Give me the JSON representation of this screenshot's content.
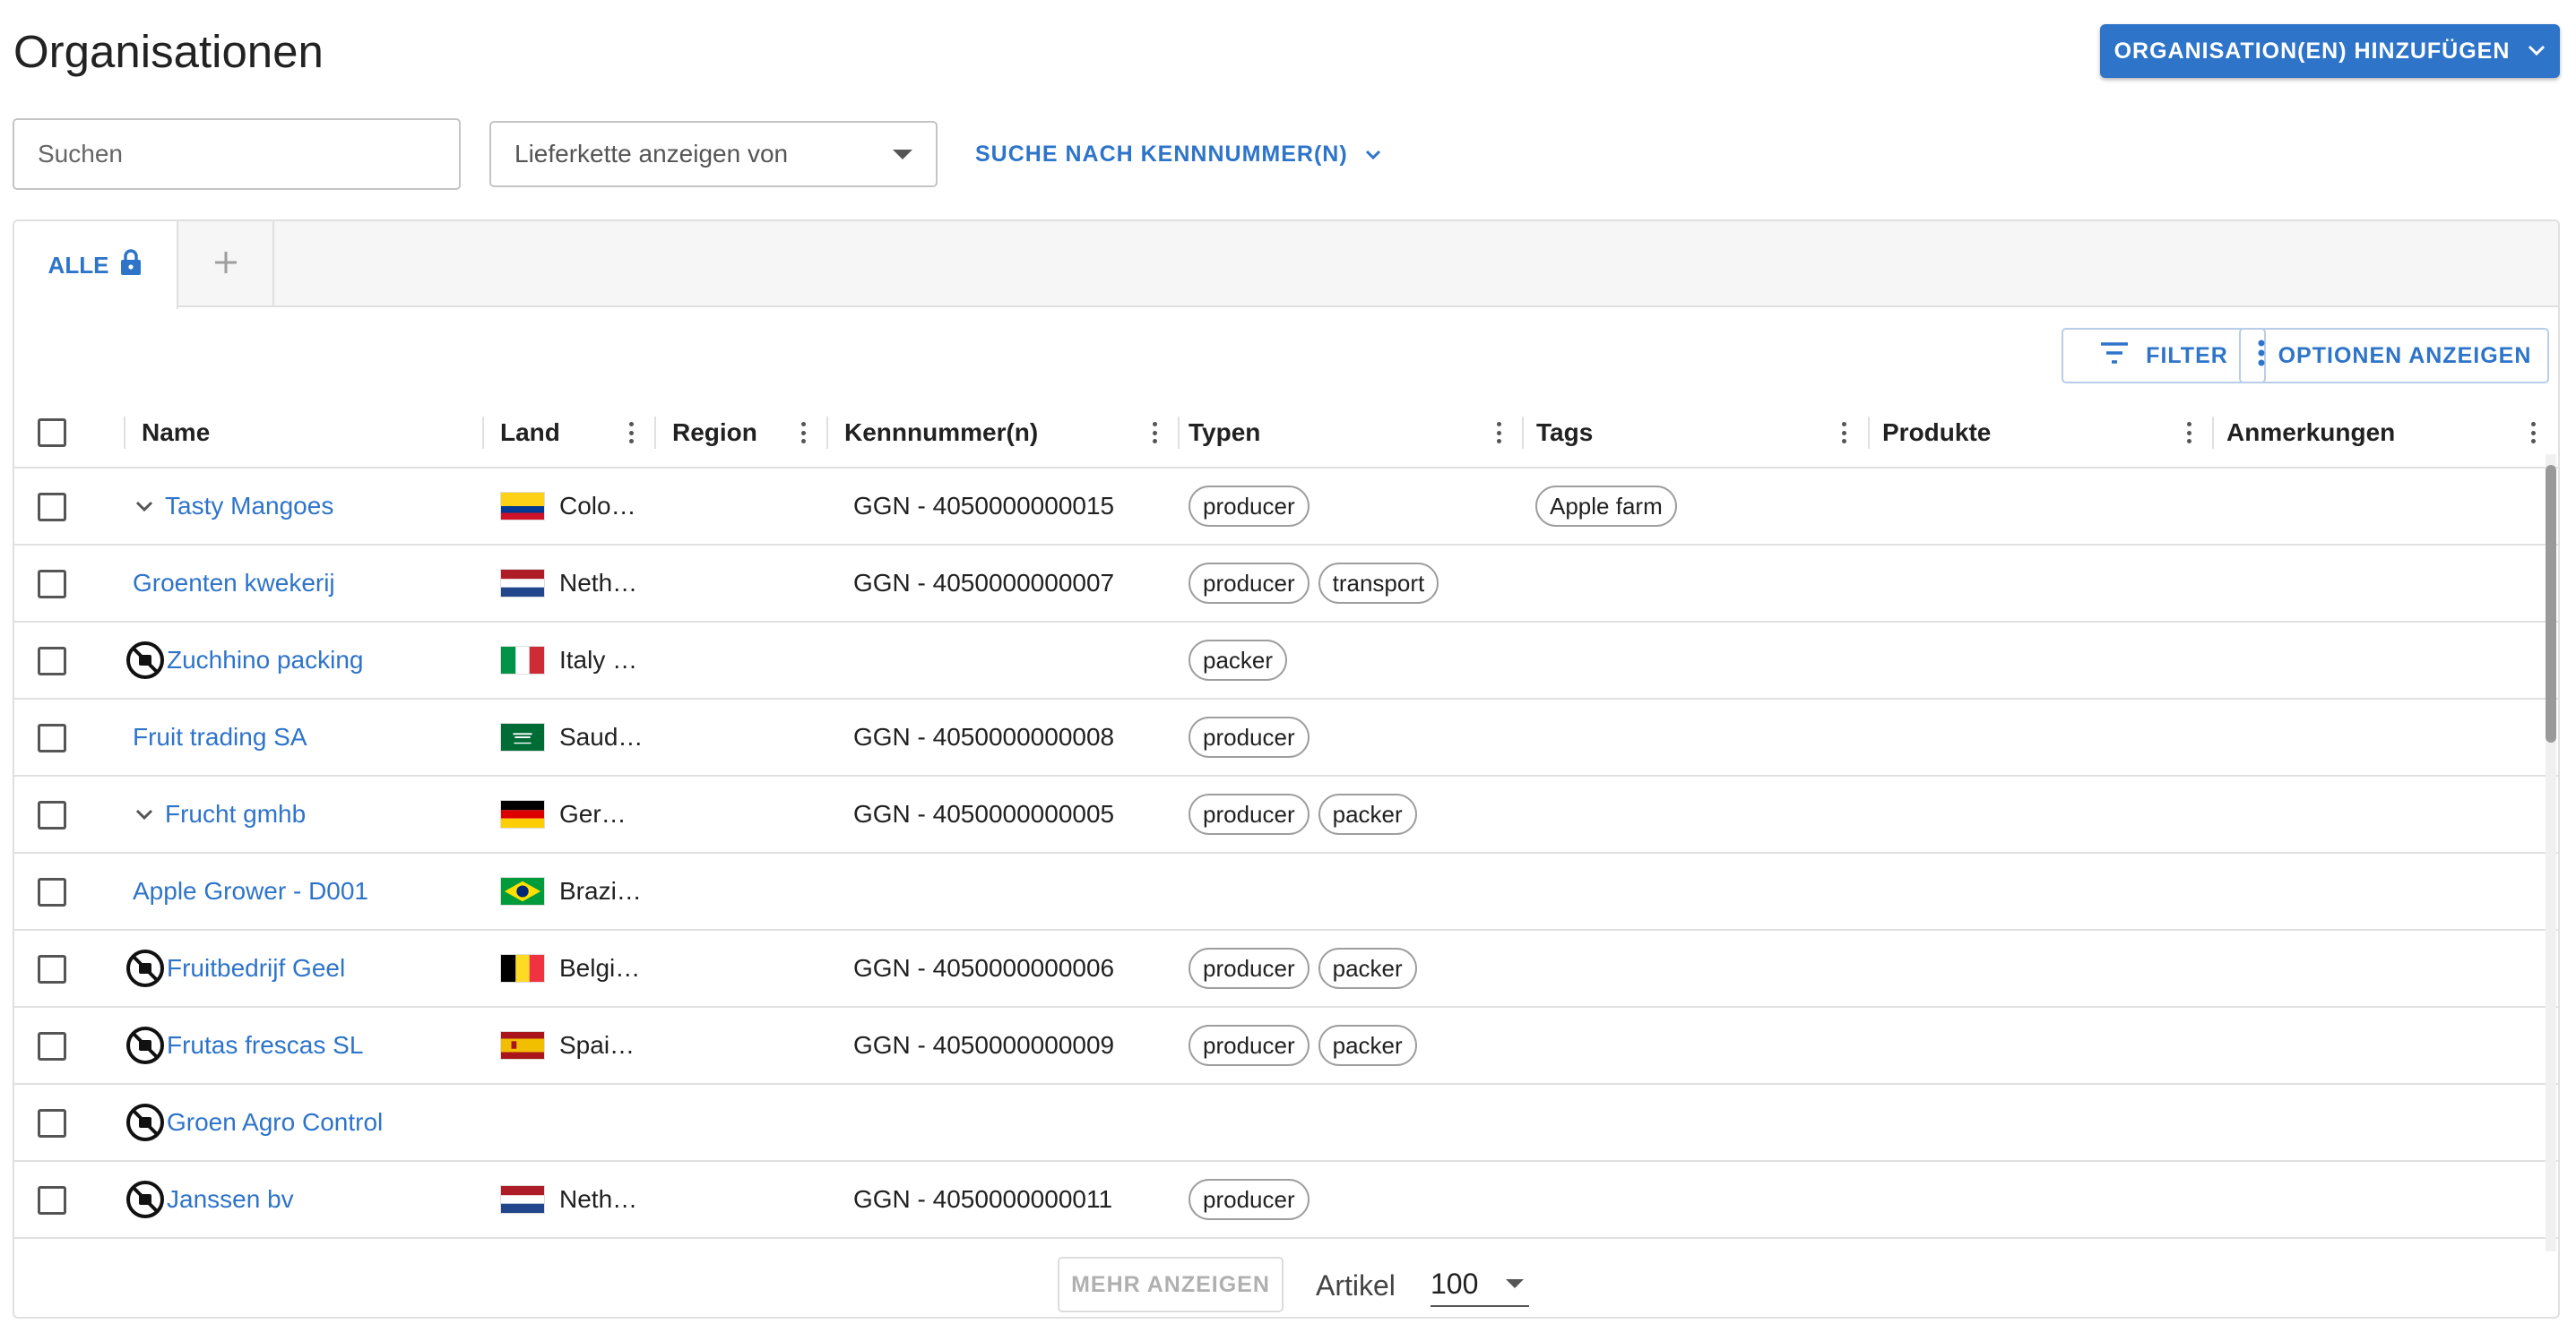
{
  "header": {
    "title": "Organisationen",
    "add_button_label": "ORGANISATION(EN) HINZUFÜGEN"
  },
  "toolbar": {
    "search_placeholder": "Suchen",
    "supply_chain_placeholder": "Lieferkette anzeigen von",
    "id_search_label": "SUCHE NACH KENNNUMMER(N)"
  },
  "tabs": {
    "all_label": "ALLE"
  },
  "actions": {
    "filter_label": "FILTER",
    "options_label": "OPTIONEN ANZEIGEN"
  },
  "columns": [
    "Name",
    "Land",
    "Region",
    "Kennnummer(n)",
    "Typen",
    "Tags",
    "Produkte",
    "Anmerkungen"
  ],
  "rows": [
    {
      "name": "Tasty Mangoes",
      "icon": "expand",
      "country": "Colo…",
      "flag": "colombia",
      "id": "GGN - 4050000000015",
      "types": [
        "producer"
      ],
      "tags": [
        "Apple farm"
      ]
    },
    {
      "name": "Groenten kwekerij",
      "icon": "none",
      "country": "Neth…",
      "flag": "netherlands",
      "id": "GGN - 4050000000007",
      "types": [
        "producer",
        "transport"
      ],
      "tags": []
    },
    {
      "name": "Zuchhino packing",
      "icon": "blocked",
      "country": "Italy …",
      "flag": "italy",
      "id": "",
      "types": [
        "packer"
      ],
      "tags": []
    },
    {
      "name": "Fruit trading SA",
      "icon": "none",
      "country": "Saud…",
      "flag": "saudi-arabia",
      "id": "GGN - 4050000000008",
      "types": [
        "producer"
      ],
      "tags": []
    },
    {
      "name": "Frucht gmhb",
      "icon": "expand",
      "country": "Ger…",
      "flag": "germany",
      "id": "GGN - 4050000000005",
      "types": [
        "producer",
        "packer"
      ],
      "tags": []
    },
    {
      "name": "Apple Grower - D001",
      "icon": "none",
      "country": "Brazi…",
      "flag": "brazil",
      "id": "",
      "types": [],
      "tags": []
    },
    {
      "name": "Fruitbedrijf Geel",
      "icon": "blocked",
      "country": "Belgi…",
      "flag": "belgium",
      "id": "GGN - 4050000000006",
      "types": [
        "producer",
        "packer"
      ],
      "tags": []
    },
    {
      "name": "Frutas frescas SL",
      "icon": "blocked",
      "country": "Spai…",
      "flag": "spain",
      "id": "GGN - 4050000000009",
      "types": [
        "producer",
        "packer"
      ],
      "tags": []
    },
    {
      "name": "Groen Agro Control",
      "icon": "blocked",
      "country": "",
      "flag": "",
      "id": "",
      "types": [],
      "tags": []
    },
    {
      "name": "Janssen bv",
      "icon": "blocked",
      "country": "Neth…",
      "flag": "netherlands",
      "id": "GGN - 4050000000011",
      "types": [
        "producer"
      ],
      "tags": []
    }
  ],
  "footer": {
    "more_label": "MEHR ANZEIGEN",
    "items_label": "Artikel",
    "page_size": "100"
  },
  "colors": {
    "accent": "#2e74c9",
    "border": "#e0e0e0"
  }
}
